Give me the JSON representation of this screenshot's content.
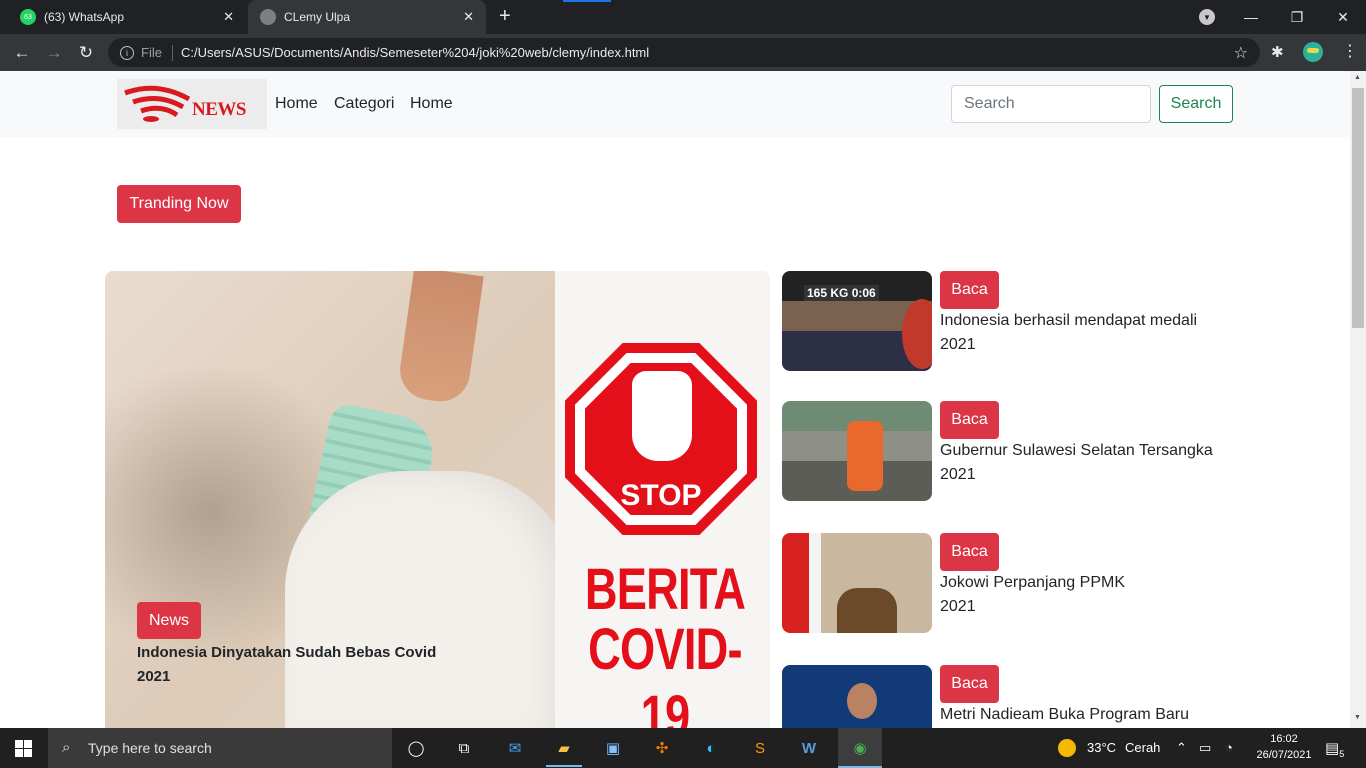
{
  "browser": {
    "tabs": [
      {
        "title": "(63) WhatsApp",
        "badge": "63",
        "active": false
      },
      {
        "title": "CLemy Ulpa",
        "active": true
      }
    ],
    "new_tab_icon": "plus-icon",
    "url_scheme": "File",
    "url": "C:/Users/ASUS/Documents/Andis/Semeseter%204/joki%20web/clemy/index.html"
  },
  "site": {
    "logo_text": "NEWS",
    "nav": [
      "Home",
      "Categori",
      "Home"
    ],
    "search_placeholder": "Search",
    "search_button": "Search",
    "trending_button": "Tranding Now",
    "hero": {
      "image_text_stop": "STOP",
      "image_text_line1": "BERITA",
      "image_text_line2": "COVID-19",
      "tag": "News",
      "title": "Indonesia Dinyatakan Sudah Bebas Covid 2021"
    },
    "side_articles": [
      {
        "button": "Baca",
        "title": "Indonesia berhasil mendapat medali",
        "year": "2021"
      },
      {
        "button": "Baca",
        "title": "Gubernur Sulawesi Selatan Tersangka",
        "year": "2021"
      },
      {
        "button": "Baca",
        "title": "Jokowi Perpanjang PPMK",
        "year": "2021"
      },
      {
        "button": "Baca",
        "title": "Metri Nadieam Buka Program Baru",
        "year": ""
      }
    ]
  },
  "taskbar": {
    "search_placeholder": "Type here to search",
    "weather_temp": "33°C",
    "weather_text": "Cerah",
    "time": "16:02",
    "date": "26/07/2021",
    "notification_count": "5"
  }
}
